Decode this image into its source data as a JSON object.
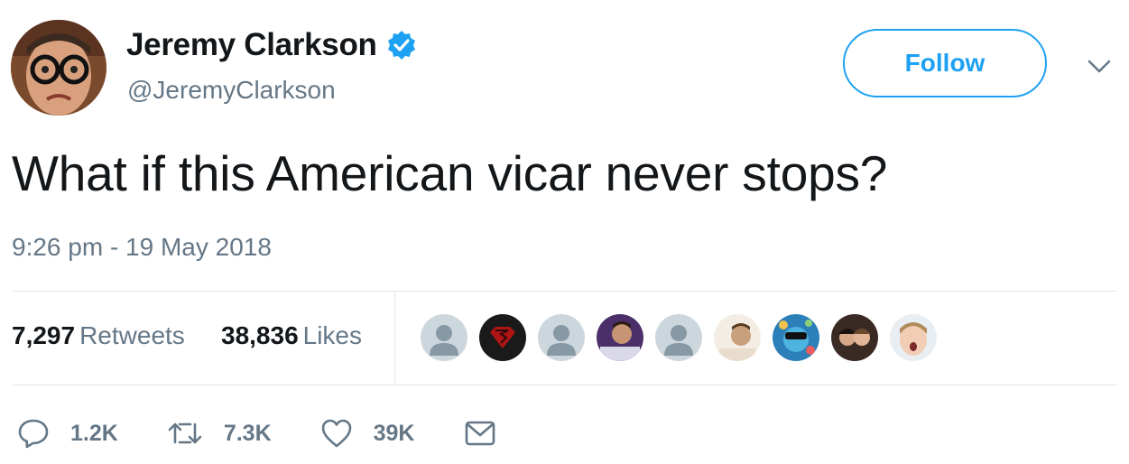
{
  "user": {
    "display_name": "Jeremy Clarkson",
    "handle": "@JeremyClarkson",
    "verified": true
  },
  "follow_label": "Follow",
  "tweet": {
    "text": "What if this American vicar never stops?",
    "timestamp": "9:26 pm - 19 May 2018"
  },
  "stats": {
    "retweets_count": "7,297",
    "retweets_label": "Retweets",
    "likes_count": "38,836",
    "likes_label": "Likes"
  },
  "likers": [
    {
      "icon": "default-avatar-icon"
    },
    {
      "icon": "superman-logo-avatar"
    },
    {
      "icon": "default-avatar-icon"
    },
    {
      "icon": "photo-avatar"
    },
    {
      "icon": "default-avatar-icon"
    },
    {
      "icon": "photo-avatar"
    },
    {
      "icon": "cartoon-avatar"
    },
    {
      "icon": "photo-avatar"
    },
    {
      "icon": "photo-avatar"
    }
  ],
  "actions": {
    "reply_count": "1.2K",
    "retweet_count": "7.3K",
    "like_count": "39K"
  },
  "colors": {
    "accent": "#1da1f2",
    "secondary_text": "#657786",
    "primary_text": "#14171a",
    "border": "#e1e8ed"
  }
}
